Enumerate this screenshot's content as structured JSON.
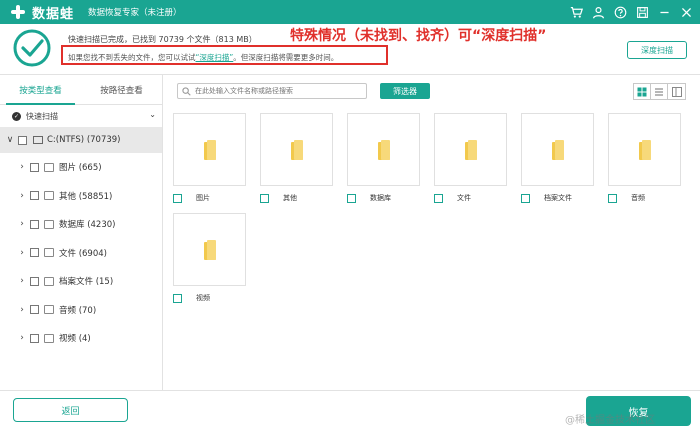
{
  "app": {
    "logo_text": "数据蛙",
    "window_title": "数据恢复专家（未注册）"
  },
  "colors": {
    "accent": "#1aa592",
    "annotation_red": "#e0302b",
    "folder": "#f2c94c"
  },
  "title_icons": [
    "cart-icon",
    "user-icon",
    "help-icon",
    "save-icon",
    "minimize-icon",
    "close-icon"
  ],
  "status": {
    "line1": "快速扫描已完成，已找到 70739 个文件（813 MB）",
    "line2_prefix": "如果您找不到丢失的文件，您可以试试",
    "line2_link": "“深度扫描”",
    "line2_suffix": "。但深度扫描将需要更多时间。",
    "deep_scan_button": "深度扫描"
  },
  "annotation": "特殊情况（未找到、找齐）可“深度扫描”",
  "left_panel": {
    "tabs": [
      "按类型查看",
      "按路径查看"
    ],
    "quick_scan": "快速扫描",
    "drive": "C:(NTFS) (70739)",
    "categories": [
      {
        "label": "图片 (665)"
      },
      {
        "label": "其他 (58851)"
      },
      {
        "label": "数据库 (4230)"
      },
      {
        "label": "文件 (6904)"
      },
      {
        "label": "档案文件 (15)"
      },
      {
        "label": "音频 (70)"
      },
      {
        "label": "视频 (4)"
      }
    ]
  },
  "toolbar": {
    "search_placeholder": "在此处输入文件名称或路径搜索",
    "filter_button": "筛选器"
  },
  "folders": [
    {
      "label": "图片"
    },
    {
      "label": "其他"
    },
    {
      "label": "数据库"
    },
    {
      "label": "文件"
    },
    {
      "label": "档案文件"
    },
    {
      "label": "音频"
    },
    {
      "label": "视频"
    }
  ],
  "bottom": {
    "back_button": "返回",
    "recover_button": "恢复",
    "watermark": "@稀土掘金技术社区"
  }
}
